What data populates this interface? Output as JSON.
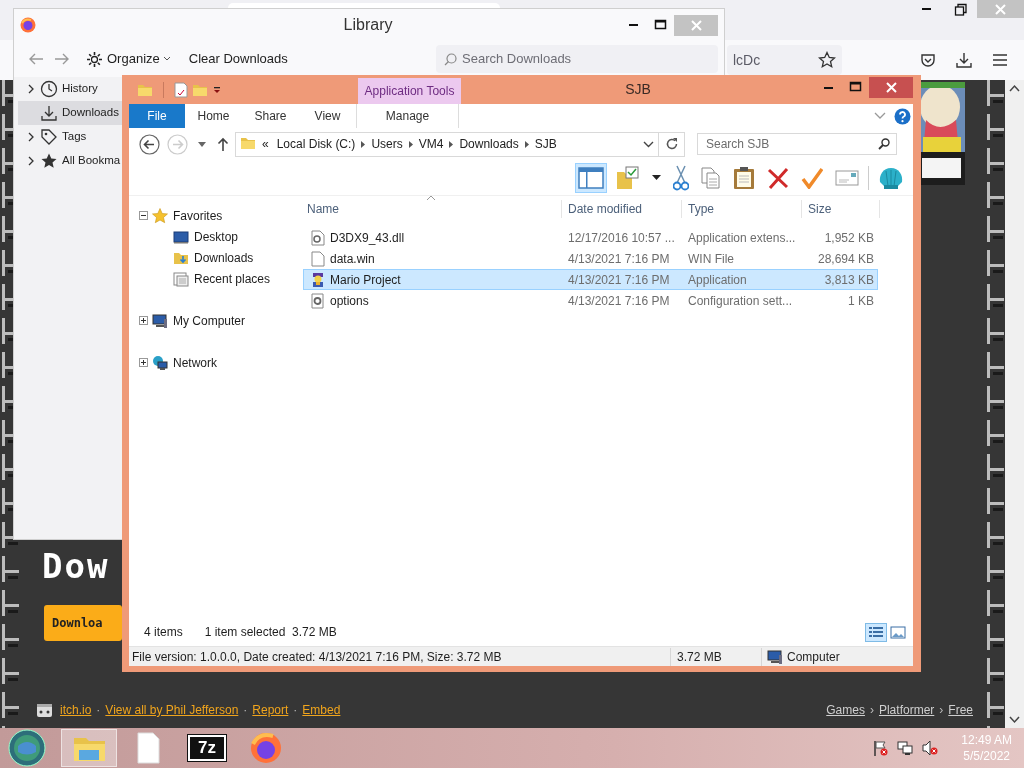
{
  "browser": {
    "address": "lcDc",
    "page": {
      "heading": "Dow",
      "download_button": "Downloa",
      "footer_left": [
        {
          "kind": "link",
          "text": "itch.io"
        },
        {
          "kind": "sep",
          "text": "·"
        },
        {
          "kind": "link",
          "text": "View all by Phil Jefferson"
        },
        {
          "kind": "sep",
          "text": "·"
        },
        {
          "kind": "link",
          "text": "Report"
        },
        {
          "kind": "sep",
          "text": "·"
        },
        {
          "kind": "link",
          "text": "Embed"
        }
      ],
      "footer_right": [
        {
          "kind": "link",
          "text": "Games"
        },
        {
          "kind": "sep",
          "text": "›"
        },
        {
          "kind": "link",
          "text": "Platformer"
        },
        {
          "kind": "sep",
          "text": "›"
        },
        {
          "kind": "link",
          "text": "Free"
        }
      ]
    }
  },
  "library": {
    "title": "Library",
    "organize": "Organize",
    "clear": "Clear Downloads",
    "search_placeholder": "Search Downloads",
    "sidebar": [
      {
        "kind": "history",
        "label": "History",
        "expandable": true,
        "selected": false
      },
      {
        "kind": "downloads",
        "label": "Downloads",
        "expandable": false,
        "selected": true
      },
      {
        "kind": "tags",
        "label": "Tags",
        "expandable": true,
        "selected": false
      },
      {
        "kind": "bookmarks",
        "label": "All Bookma",
        "expandable": true,
        "selected": false
      }
    ]
  },
  "explorer": {
    "title": "SJB",
    "contextual_tab": "Application Tools",
    "tabs": [
      {
        "kind": "file",
        "label": "File"
      },
      {
        "kind": "tab",
        "label": "Home"
      },
      {
        "kind": "tab",
        "label": "Share"
      },
      {
        "kind": "tab",
        "label": "View"
      },
      {
        "kind": "contextual",
        "label": "Manage"
      }
    ],
    "address": {
      "overflow": "«",
      "crumbs": [
        "Local Disk (C:)",
        "Users",
        "VM4",
        "Downloads",
        "SJB"
      ]
    },
    "search_placeholder": "Search SJB",
    "nav": [
      {
        "kind": "favorites",
        "label": "Favorites",
        "expanded": true,
        "children": [
          {
            "kind": "desktop",
            "label": "Desktop"
          },
          {
            "kind": "downloads",
            "label": "Downloads"
          },
          {
            "kind": "recent",
            "label": "Recent places"
          }
        ]
      },
      {
        "kind": "computer",
        "label": "My Computer",
        "expanded": false
      },
      {
        "kind": "network",
        "label": "Network",
        "expanded": false
      }
    ],
    "columns": [
      "Name",
      "Date modified",
      "Type",
      "Size"
    ],
    "rows": [
      {
        "kind": "dll",
        "name": "D3DX9_43.dll",
        "date": "12/17/2016 10:57 ...",
        "type": "Application extens...",
        "size": "1,952 KB",
        "selected": false
      },
      {
        "kind": "file",
        "name": "data.win",
        "date": "4/13/2021 7:16 PM",
        "type": "WIN File",
        "size": "28,694 KB",
        "selected": false
      },
      {
        "kind": "app",
        "name": "Mario Project",
        "date": "4/13/2021 7:16 PM",
        "type": "Application",
        "size": "3,813 KB",
        "selected": true
      },
      {
        "kind": "config",
        "name": "options",
        "date": "4/13/2021 7:16 PM",
        "type": "Configuration sett...",
        "size": "1 KB",
        "selected": false
      }
    ],
    "item_count": "4 items",
    "selection": "1 item selected  3.72 MB",
    "views": [
      {
        "kind": "details",
        "selected": true
      },
      {
        "kind": "thumbnails",
        "selected": false
      }
    ],
    "status_bar": {
      "details": "File version: 1.0.0.0, Date created: 4/13/2021 7:16 PM, Size: 3.72 MB",
      "size": "3.72 MB",
      "location": "Computer"
    }
  },
  "taskbar": {
    "items": [
      {
        "kind": "explorer",
        "selected": true
      },
      {
        "kind": "document",
        "selected": false
      },
      {
        "kind": "archiver",
        "label": "7z",
        "selected": false
      },
      {
        "kind": "browser",
        "selected": false
      }
    ],
    "time": "12:49 AM",
    "date": "5/5/2022"
  }
}
